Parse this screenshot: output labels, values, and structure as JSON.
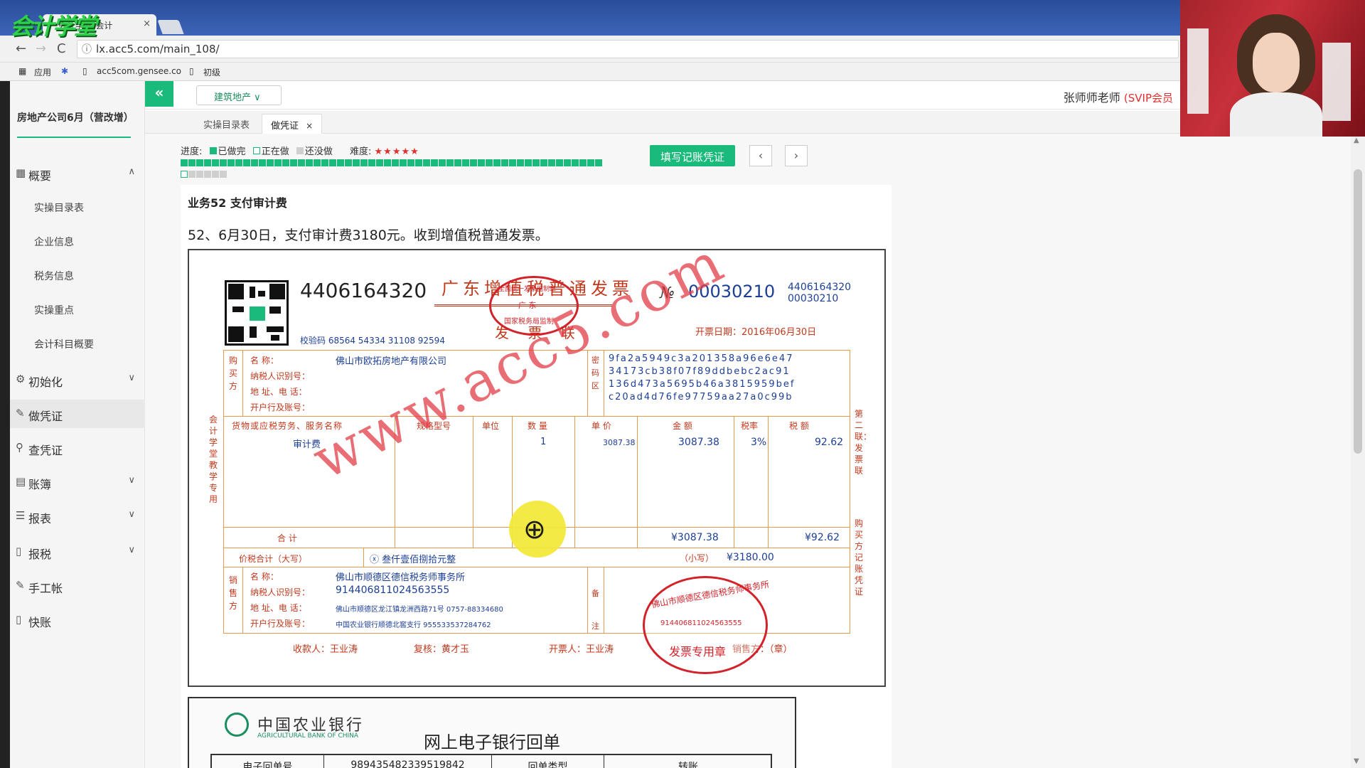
{
  "browser": {
    "logo_text": "会计学堂",
    "tab_title": "会计学堂-会计",
    "tab_close": "×",
    "back": "←",
    "forward": "→",
    "reload": "C",
    "url": "lx.acc5.com/main_108/",
    "url_info": "ⓘ",
    "bookmarks": [
      "应用",
      "acc5com.gensee.co",
      "初级"
    ]
  },
  "sidebar": {
    "company": "房地产公司6月（营改增）",
    "menu": [
      {
        "label": "概要",
        "icon": "grid-icon",
        "glyph": "▦",
        "chevron": "∧"
      },
      {
        "label": "初始化",
        "icon": "gear-icon",
        "glyph": "⚙",
        "chevron": "∨"
      },
      {
        "label": "做凭证",
        "icon": "pen-icon",
        "glyph": "✎",
        "chevron": ""
      },
      {
        "label": "查凭证",
        "icon": "search-icon",
        "glyph": "⚲",
        "chevron": ""
      },
      {
        "label": "账簿",
        "icon": "book-icon",
        "glyph": "▤",
        "chevron": "∨"
      },
      {
        "label": "报表",
        "icon": "list-icon",
        "glyph": "☰",
        "chevron": "∨"
      },
      {
        "label": "报税",
        "icon": "file-icon",
        "glyph": "▯",
        "chevron": "∨"
      },
      {
        "label": "手工帐",
        "icon": "pen-icon",
        "glyph": "✎",
        "chevron": ""
      },
      {
        "label": "快账",
        "icon": "file-icon",
        "glyph": "▯",
        "chevron": ""
      }
    ],
    "submenu": [
      "实操目录表",
      "企业信息",
      "税务信息",
      "实操重点",
      "会计科目概要"
    ]
  },
  "topbar": {
    "collapse": "«",
    "industry": "建筑地产",
    "industry_chevron": "∨",
    "teacher": "张师师老师",
    "vip": "(SVIP会员"
  },
  "tabs": {
    "catalog": "实操目录表",
    "voucher": "做凭证",
    "close": "×"
  },
  "progress": {
    "label": "进度:",
    "done": "已做完",
    "doing": "正在做",
    "not_done": "还没做",
    "difficulty": "难度:",
    "stars": "★★★★★",
    "done_count": 51,
    "current_index": 54,
    "total": 60
  },
  "actions": {
    "fill_voucher": "填写记账凭证",
    "prev": "‹",
    "next": "›"
  },
  "task": {
    "title": "业务52 支付审计费",
    "description": "52、6月30日，支付审计费3180元。收到增值税普通发票。"
  },
  "invoice": {
    "code": "4406164320",
    "title": "广东增值税普通发票",
    "copy_label": "发 票 联",
    "no_label": "№",
    "number": "00030210",
    "code_small": "4406164320",
    "number_small": "00030210",
    "check_code": "校验码 68564 54334 31108 92594",
    "date": "开票日期：2016年06月30日",
    "buyer_side": "购买方",
    "buyer_labels": [
      "名    称：",
      "纳税人识别号：",
      "地 址、电 话：",
      "开户行及账号："
    ],
    "buyer_name": "佛山市欧拓房地产有限公司",
    "cipher_side": "密码区",
    "cipher": [
      "9fa2a5949c3a201358a96e6e47",
      "34173cb38f07f89ddbebc2ac91",
      "136d473a5695b46a3815959bef",
      "c20ad4d76fe97759aa27a0c99b"
    ],
    "headers": [
      "货物或应税劳务、服务名称",
      "规格型号",
      "单位",
      "数 量",
      "单 价",
      "金 额",
      "税率",
      "税 额"
    ],
    "item_name": "审计费",
    "quantity": "1",
    "unit_price": "3087.38",
    "amount": "3087.38",
    "tax_rate": "3%",
    "tax": "92.62",
    "total_label": "合          计",
    "total_amount": "¥3087.38",
    "total_tax": "¥92.62",
    "grand_label": "价税合计（大写）",
    "grand_words": "ⓧ 叁仟壹佰捌拾元整",
    "grand_small_label": "（小写）",
    "grand_small": "¥3180.00",
    "seller_side": "销售方",
    "seller_labels": [
      "名    称：",
      "纳税人识别号：",
      "地 址、电 话：",
      "开户行及账号："
    ],
    "seller_name": "佛山市顺德区德信税务师事务所",
    "seller_tax_id": "914406811024563555",
    "seller_address": "佛山市顺德区龙江镇龙洲西路71号 0757-88334680",
    "seller_bank": "中国农业银行顺德北窖支行 955533537284762",
    "remark_side": "备注",
    "left_vertical": "会计学堂教学专用",
    "right_vertical_1": "第二联：发票联",
    "right_vertical_2": "购买方记账凭证",
    "payee": "收款人：王业涛",
    "reviewer": "复核：黄才玉",
    "drawer": "开票人：王业涛",
    "seller_stamp_label": "销售方：（章）",
    "stamp1_text": "全国统一发票监制章",
    "stamp1_region": "广  东",
    "stamp1_sub": "国家税务局监制",
    "stamp2_text": "佛山市顺德区德信税务师事务所",
    "stamp2_id": "914406811024563555",
    "stamp2_sub": "发票专用章",
    "watermark": "www.acc5.com"
  },
  "bank": {
    "name": "中国农业银行",
    "name_en": "AGRICULTURAL BANK OF CHINA",
    "title": "网上电子银行回单",
    "cells": [
      "电子回单号",
      "989435482339519842",
      "回单类型",
      "转账"
    ]
  },
  "zoom_icon": "⊕"
}
